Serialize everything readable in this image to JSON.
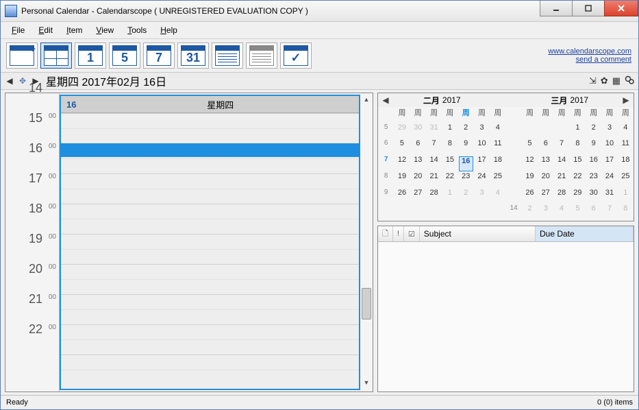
{
  "title": "Personal Calendar - Calendarscope ( UNREGISTERED EVALUATION COPY )",
  "menus": {
    "file": "File",
    "edit": "Edit",
    "item": "Item",
    "view": "View",
    "tools": "Tools",
    "help": "Help"
  },
  "toolbar_nums": {
    "d1": "1",
    "d5": "5",
    "d7": "7",
    "d31": "31"
  },
  "links": {
    "site": "www.calendarscope.com",
    "feedback": "send a comment"
  },
  "nav": {
    "date": "星期四 2017年02月 16日"
  },
  "day": {
    "num": "16",
    "weekday": "星期四",
    "hours": [
      "14",
      "15",
      "16",
      "17",
      "18",
      "19",
      "20",
      "21",
      "22"
    ]
  },
  "minical": [
    {
      "title": "二月",
      "year": "2017",
      "arrow": "l",
      "dow": [
        "周",
        "周",
        "周",
        "周",
        "周",
        "周",
        "周"
      ],
      "weeks": [
        {
          "n": "5",
          "d": [
            "29",
            "30",
            "31",
            "1",
            "2",
            "3",
            "4"
          ],
          "other": [
            0,
            1,
            2
          ]
        },
        {
          "n": "6",
          "d": [
            "5",
            "6",
            "7",
            "8",
            "9",
            "10",
            "11"
          ]
        },
        {
          "n": "7",
          "d": [
            "12",
            "13",
            "14",
            "15",
            "16",
            "17",
            "18"
          ],
          "today": 4,
          "hl": true
        },
        {
          "n": "8",
          "d": [
            "19",
            "20",
            "21",
            "22",
            "23",
            "24",
            "25"
          ]
        },
        {
          "n": "9",
          "d": [
            "26",
            "27",
            "28",
            "1",
            "2",
            "3",
            "4"
          ],
          "other": [
            3,
            4,
            5,
            6
          ]
        },
        {
          "n": "",
          "d": [
            "",
            "",
            "",
            "",
            "",
            "",
            ""
          ]
        }
      ]
    },
    {
      "title": "三月",
      "year": "2017",
      "arrow": "r",
      "dow": [
        "周",
        "周",
        "周",
        "周",
        "周",
        "周",
        "周"
      ],
      "weeks": [
        {
          "n": "",
          "d": [
            "",
            "",
            "",
            "1",
            "2",
            "3",
            "4"
          ]
        },
        {
          "n": "",
          "d": [
            "5",
            "6",
            "7",
            "8",
            "9",
            "10",
            "11"
          ]
        },
        {
          "n": "",
          "d": [
            "12",
            "13",
            "14",
            "15",
            "16",
            "17",
            "18"
          ]
        },
        {
          "n": "",
          "d": [
            "19",
            "20",
            "21",
            "22",
            "23",
            "24",
            "25"
          ]
        },
        {
          "n": "",
          "d": [
            "26",
            "27",
            "28",
            "29",
            "30",
            "31",
            "1"
          ],
          "other": [
            6
          ]
        },
        {
          "n": "14",
          "d": [
            "2",
            "3",
            "4",
            "5",
            "6",
            "7",
            "8"
          ],
          "other": [
            0,
            1,
            2,
            3,
            4,
            5,
            6
          ]
        }
      ]
    }
  ],
  "tasks": {
    "subject": "Subject",
    "due": "Due Date"
  },
  "status": {
    "left": "Ready",
    "right": "0 (0) items"
  }
}
